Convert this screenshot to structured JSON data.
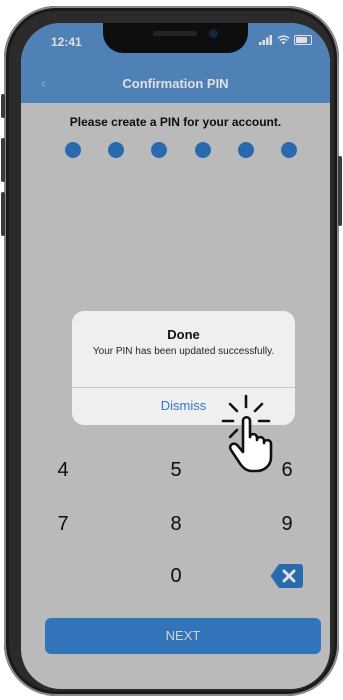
{
  "status_bar": {
    "time": "12:41",
    "signal_icon": "signal-bars-icon",
    "wifi_icon": "wifi-icon",
    "battery_icon": "battery-icon"
  },
  "header": {
    "back_icon": "chevron-left-icon",
    "back_label": "‹",
    "title": "Confirmation PIN",
    "color": "#5b93d1"
  },
  "prompt": "Please create a PIN for your account.",
  "pin": {
    "length": 6,
    "filled": 6,
    "dot_color": "#2f79c6"
  },
  "keypad": {
    "keys": [
      "4",
      "5",
      "6",
      "7",
      "8",
      "9",
      "0"
    ],
    "backspace_icon": "backspace-icon"
  },
  "next_button": {
    "label": "NEXT",
    "color": "#3a84d4"
  },
  "alert": {
    "title": "Done",
    "message": "Your PIN has been updated successfully.",
    "button_label": "Dismiss",
    "button_color": "#2f79c6"
  },
  "overlay": {
    "tap_indicator_icon": "hand-tap-icon"
  }
}
